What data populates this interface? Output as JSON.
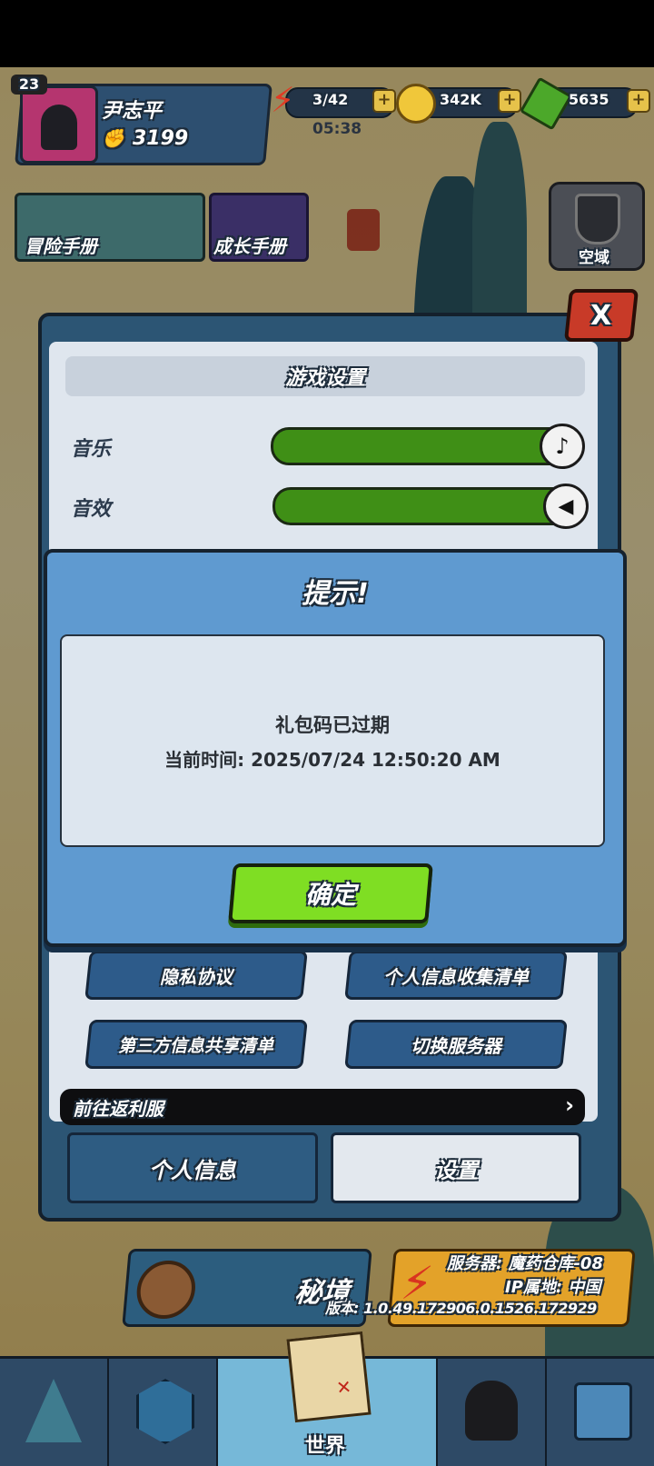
{
  "player": {
    "level": "23",
    "name": "尹志平",
    "power": "3199"
  },
  "resources": {
    "energy": "3/42",
    "energy_timer": "05:38",
    "gold": "342K",
    "gems": "5635"
  },
  "side_buttons": {
    "adventure_manual": "冒险手册",
    "growth_manual": "成长手册",
    "airspace": "空域"
  },
  "settings": {
    "title": "游戏设置",
    "music_label": "音乐",
    "sfx_label": "音效",
    "music_level": 1.0,
    "sfx_level": 1.0,
    "buttons": [
      "隐私协议",
      "个人信息收集清单",
      "第三方信息共享清单",
      "切换服务器"
    ],
    "rebate_link": "前往返利服",
    "tabs": [
      "个人信息",
      "设置"
    ],
    "close_label": "X"
  },
  "dialog": {
    "title": "提示!",
    "message": "礼包码已过期",
    "time_line": "当前时间: 2025/07/24 12:50:20 AM",
    "confirm_label": "确定"
  },
  "lower": {
    "secret_realm": "秘境",
    "server_info": "服务器: 魔药仓库-08",
    "ip_info": "IP属地: 中国",
    "version_info": "版本: 1.0.49.172906.0.1526.172929"
  },
  "bottom_nav": {
    "world_label": "世界"
  },
  "colors": {
    "accent_green": "#7fde23",
    "dialog_blue": "#5f9ad0",
    "panel_blue": "#2c5574"
  }
}
